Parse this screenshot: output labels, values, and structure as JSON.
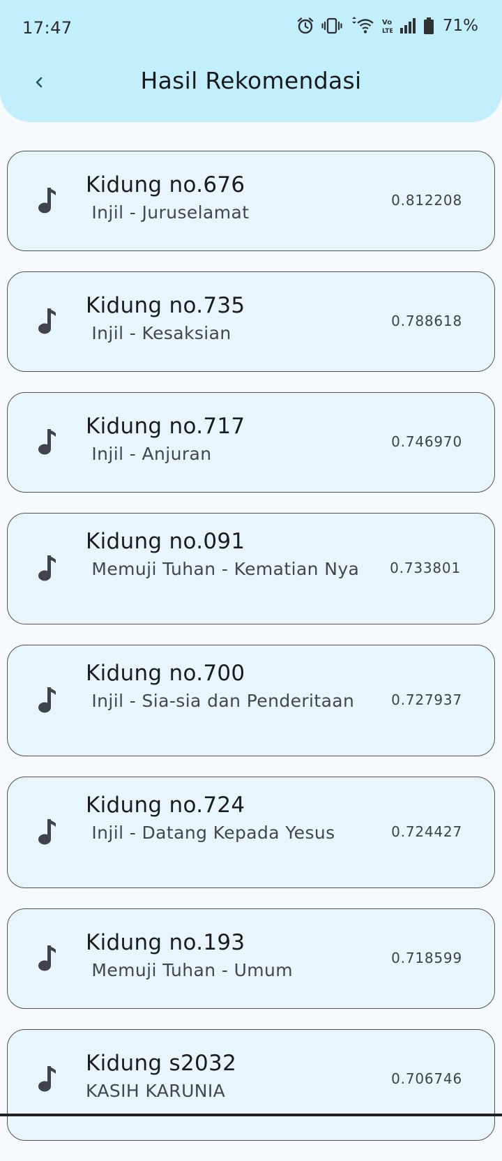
{
  "status": {
    "time": "17:47",
    "battery": "71%"
  },
  "header": {
    "title": "Hasil Rekomendasi"
  },
  "icons": {
    "back": "chevron-left-icon",
    "item": "music-note-icon"
  },
  "colors": {
    "header_bg": "#c3effd",
    "card_bg": "#e8f6fc",
    "page_bg": "#f6fafd"
  },
  "items": [
    {
      "title": "Kidung no.676",
      "subtitle": " Injil - Juruselamat",
      "score": "0.812208"
    },
    {
      "title": "Kidung no.735",
      "subtitle": " Injil - Kesaksian",
      "score": "0.788618"
    },
    {
      "title": "Kidung no.717",
      "subtitle": " Injil - Anjuran",
      "score": "0.746970"
    },
    {
      "title": "Kidung no.091",
      "subtitle": " Memuji Tuhan - Kematian Nya",
      "score": "0.733801"
    },
    {
      "title": "Kidung no.700",
      "subtitle": " Injil - Sia-sia dan Penderitaan",
      "score": "0.727937"
    },
    {
      "title": "Kidung no.724",
      "subtitle": " Injil - Datang Kepada Yesus",
      "score": "0.724427"
    },
    {
      "title": "Kidung no.193",
      "subtitle": " Memuji Tuhan - Umum",
      "score": "0.718599"
    },
    {
      "title": "Kidung s2032",
      "subtitle": "KASIH KARUNIA",
      "score": "0.706746"
    }
  ]
}
